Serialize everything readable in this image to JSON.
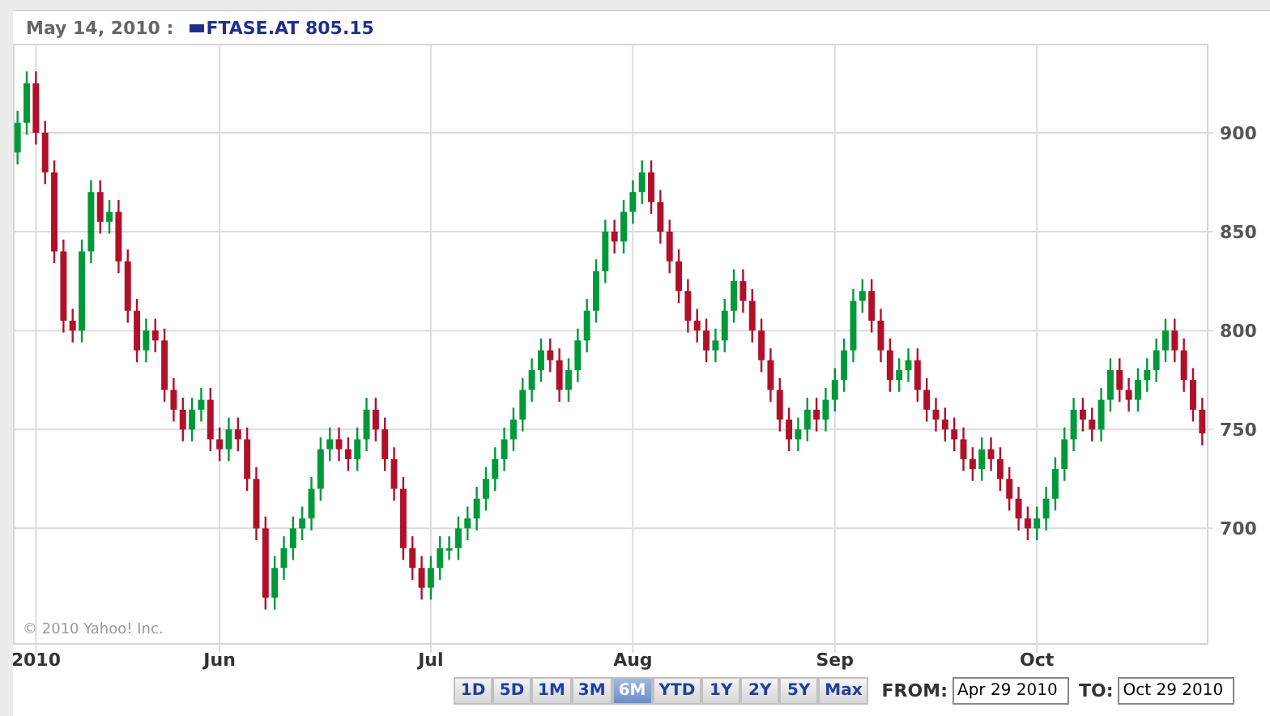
{
  "header": {
    "date": "May 14, 2010 :",
    "legend": {
      "symbol": "FTASE.AT 805.15",
      "color": "#1f2f8f"
    }
  },
  "chart": {
    "copyright": "© 2010 Yahoo! Inc.",
    "chart_data": {
      "type": "candlestick",
      "grid": true,
      "ylim": [
        642,
        945
      ],
      "yticks": [
        700,
        750,
        800,
        850,
        900
      ],
      "categories": [
        null,
        null,
        "2010",
        null,
        null,
        null,
        null,
        null,
        null,
        null,
        null,
        null,
        null,
        null,
        null,
        null,
        null,
        null,
        null,
        null,
        null,
        null,
        "Jun",
        null,
        null,
        null,
        null,
        null,
        null,
        null,
        null,
        null,
        null,
        null,
        null,
        null,
        null,
        null,
        null,
        null,
        null,
        null,
        null,
        null,
        null,
        "Jul",
        null,
        null,
        null,
        null,
        null,
        null,
        null,
        null,
        null,
        null,
        null,
        null,
        null,
        null,
        null,
        null,
        null,
        null,
        null,
        null,
        null,
        "Aug",
        null,
        null,
        null,
        null,
        null,
        null,
        null,
        null,
        null,
        null,
        null,
        null,
        null,
        null,
        null,
        null,
        null,
        null,
        null,
        null,
        null,
        "Sep",
        null,
        null,
        null,
        null,
        null,
        null,
        null,
        null,
        null,
        null,
        null,
        null,
        null,
        null,
        null,
        null,
        null,
        null,
        null,
        null,
        null,
        "Oct",
        null,
        null,
        null,
        null,
        null,
        null,
        null,
        null,
        null,
        null,
        null,
        null,
        null,
        null,
        null,
        null,
        null,
        null
      ],
      "ohlc": [
        [
          890,
          911,
          884,
          905
        ],
        [
          905,
          931,
          899,
          925
        ],
        [
          925,
          931,
          894,
          900
        ],
        [
          900,
          906,
          874,
          880
        ],
        [
          880,
          886,
          834,
          840
        ],
        [
          840,
          846,
          799,
          805
        ],
        [
          805,
          811,
          794,
          800
        ],
        [
          800,
          846,
          794,
          840
        ],
        [
          840,
          876,
          834,
          870
        ],
        [
          870,
          876,
          849,
          855
        ],
        [
          855,
          866,
          849,
          860
        ],
        [
          860,
          866,
          829,
          835
        ],
        [
          835,
          841,
          804,
          810
        ],
        [
          810,
          816,
          784,
          790
        ],
        [
          790,
          806,
          784,
          800
        ],
        [
          800,
          806,
          789,
          795
        ],
        [
          795,
          801,
          764,
          770
        ],
        [
          770,
          776,
          754,
          760
        ],
        [
          760,
          766,
          744,
          750
        ],
        [
          750,
          766,
          744,
          760
        ],
        [
          760,
          771,
          754,
          765
        ],
        [
          765,
          771,
          739,
          745
        ],
        [
          745,
          751,
          734,
          740
        ],
        [
          740,
          756,
          734,
          750
        ],
        [
          750,
          756,
          739,
          745
        ],
        [
          745,
          751,
          719,
          725
        ],
        [
          725,
          731,
          694,
          700
        ],
        [
          700,
          706,
          659,
          665
        ],
        [
          665,
          686,
          659,
          680
        ],
        [
          680,
          696,
          674,
          690
        ],
        [
          690,
          706,
          684,
          700
        ],
        [
          700,
          711,
          694,
          705
        ],
        [
          705,
          726,
          699,
          720
        ],
        [
          720,
          746,
          714,
          740
        ],
        [
          740,
          751,
          734,
          745
        ],
        [
          745,
          751,
          734,
          740
        ],
        [
          740,
          746,
          729,
          735
        ],
        [
          735,
          751,
          729,
          745
        ],
        [
          745,
          766,
          739,
          760
        ],
        [
          760,
          766,
          744,
          750
        ],
        [
          750,
          756,
          729,
          735
        ],
        [
          735,
          741,
          714,
          720
        ],
        [
          720,
          726,
          684,
          690
        ],
        [
          690,
          696,
          674,
          680
        ],
        [
          680,
          686,
          664,
          670
        ],
        [
          670,
          686,
          664,
          680
        ],
        [
          680,
          696,
          674,
          690
        ],
        [
          690,
          696,
          684,
          690
        ],
        [
          690,
          706,
          684,
          700
        ],
        [
          700,
          711,
          694,
          705
        ],
        [
          705,
          721,
          699,
          715
        ],
        [
          715,
          731,
          709,
          725
        ],
        [
          725,
          741,
          719,
          735
        ],
        [
          735,
          751,
          729,
          745
        ],
        [
          745,
          761,
          739,
          755
        ],
        [
          755,
          776,
          749,
          770
        ],
        [
          770,
          786,
          764,
          780
        ],
        [
          780,
          796,
          774,
          790
        ],
        [
          790,
          796,
          779,
          785
        ],
        [
          785,
          791,
          764,
          770
        ],
        [
          770,
          786,
          764,
          780
        ],
        [
          780,
          801,
          774,
          795
        ],
        [
          795,
          816,
          789,
          810
        ],
        [
          810,
          836,
          804,
          830
        ],
        [
          830,
          856,
          824,
          850
        ],
        [
          850,
          856,
          839,
          845
        ],
        [
          845,
          866,
          839,
          860
        ],
        [
          860,
          876,
          854,
          870
        ],
        [
          870,
          886,
          864,
          880
        ],
        [
          880,
          886,
          859,
          865
        ],
        [
          865,
          871,
          844,
          850
        ],
        [
          850,
          856,
          829,
          835
        ],
        [
          835,
          841,
          814,
          820
        ],
        [
          820,
          826,
          799,
          805
        ],
        [
          805,
          811,
          794,
          800
        ],
        [
          800,
          806,
          784,
          790
        ],
        [
          790,
          801,
          784,
          795
        ],
        [
          795,
          816,
          789,
          810
        ],
        [
          810,
          831,
          804,
          825
        ],
        [
          825,
          831,
          809,
          815
        ],
        [
          815,
          821,
          794,
          800
        ],
        [
          800,
          806,
          779,
          785
        ],
        [
          785,
          791,
          764,
          770
        ],
        [
          770,
          776,
          749,
          755
        ],
        [
          755,
          761,
          739,
          745
        ],
        [
          745,
          756,
          739,
          750
        ],
        [
          750,
          766,
          744,
          760
        ],
        [
          760,
          766,
          749,
          755
        ],
        [
          755,
          771,
          749,
          765
        ],
        [
          765,
          781,
          759,
          775
        ],
        [
          775,
          796,
          769,
          790
        ],
        [
          790,
          821,
          784,
          815
        ],
        [
          815,
          826,
          809,
          820
        ],
        [
          820,
          826,
          799,
          805
        ],
        [
          805,
          811,
          784,
          790
        ],
        [
          790,
          796,
          769,
          775
        ],
        [
          775,
          786,
          769,
          780
        ],
        [
          780,
          791,
          774,
          785
        ],
        [
          785,
          791,
          764,
          770
        ],
        [
          770,
          776,
          754,
          760
        ],
        [
          760,
          766,
          749,
          755
        ],
        [
          755,
          761,
          744,
          750
        ],
        [
          750,
          756,
          739,
          745
        ],
        [
          745,
          751,
          729,
          735
        ],
        [
          735,
          741,
          724,
          730
        ],
        [
          730,
          746,
          724,
          740
        ],
        [
          740,
          746,
          729,
          735
        ],
        [
          735,
          741,
          719,
          725
        ],
        [
          725,
          731,
          709,
          715
        ],
        [
          715,
          721,
          699,
          705
        ],
        [
          705,
          711,
          694,
          700
        ],
        [
          700,
          711,
          694,
          705
        ],
        [
          705,
          721,
          699,
          715
        ],
        [
          715,
          736,
          709,
          730
        ],
        [
          730,
          751,
          724,
          745
        ],
        [
          745,
          766,
          739,
          760
        ],
        [
          760,
          766,
          749,
          755
        ],
        [
          755,
          761,
          744,
          750
        ],
        [
          750,
          771,
          744,
          765
        ],
        [
          765,
          786,
          759,
          780
        ],
        [
          780,
          786,
          764,
          770
        ],
        [
          770,
          776,
          759,
          765
        ],
        [
          765,
          781,
          759,
          775
        ],
        [
          775,
          786,
          769,
          780
        ],
        [
          780,
          796,
          774,
          790
        ],
        [
          790,
          806,
          784,
          800
        ],
        [
          800,
          806,
          784,
          790
        ],
        [
          790,
          796,
          769,
          775
        ],
        [
          775,
          781,
          754,
          760
        ],
        [
          760,
          766,
          742,
          748
        ]
      ]
    }
  },
  "range_buttons": [
    {
      "label": "1D",
      "selected": false
    },
    {
      "label": "5D",
      "selected": false
    },
    {
      "label": "1M",
      "selected": false
    },
    {
      "label": "3M",
      "selected": false
    },
    {
      "label": "6M",
      "selected": true
    },
    {
      "label": "YTD",
      "selected": false
    },
    {
      "label": "1Y",
      "selected": false
    },
    {
      "label": "2Y",
      "selected": false
    },
    {
      "label": "5Y",
      "selected": false
    },
    {
      "label": "Max",
      "selected": false
    }
  ],
  "from": {
    "label": "FROM:",
    "value": "Apr 29 2010"
  },
  "to": {
    "label": "TO:",
    "value": "Oct 29 2010"
  }
}
